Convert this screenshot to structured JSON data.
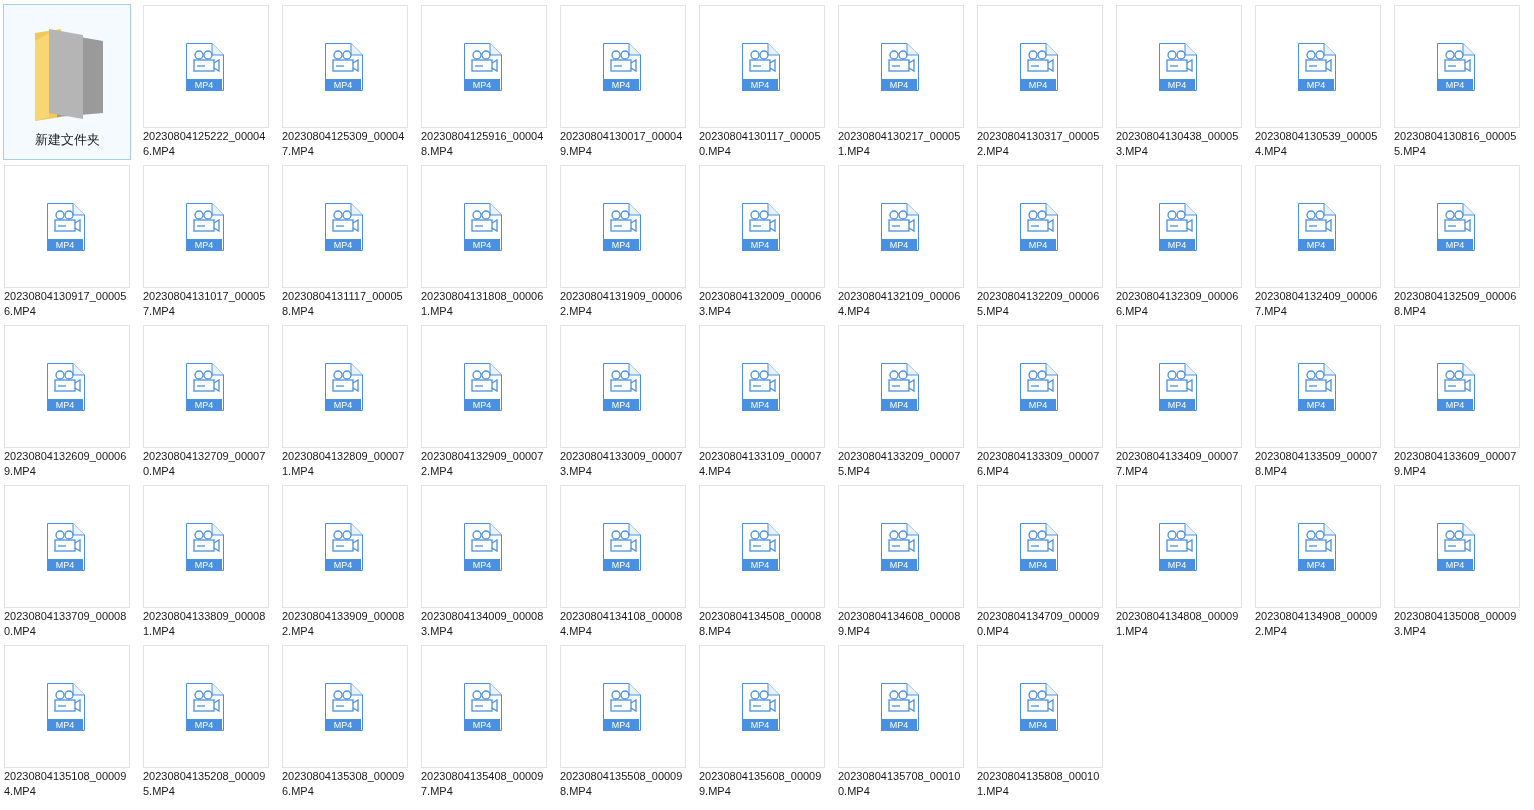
{
  "items": [
    {
      "kind": "folder",
      "name": "新建文件夹",
      "selected": true
    },
    {
      "kind": "mp4",
      "badge": "MP4",
      "name": "20230804125222_000046.MP4",
      "selected": false
    },
    {
      "kind": "mp4",
      "badge": "MP4",
      "name": "20230804125309_000047.MP4",
      "selected": false
    },
    {
      "kind": "mp4",
      "badge": "MP4",
      "name": "20230804125916_000048.MP4",
      "selected": false
    },
    {
      "kind": "mp4",
      "badge": "MP4",
      "name": "20230804130017_000049.MP4",
      "selected": false
    },
    {
      "kind": "mp4",
      "badge": "MP4",
      "name": "20230804130117_000050.MP4",
      "selected": false
    },
    {
      "kind": "mp4",
      "badge": "MP4",
      "name": "20230804130217_000051.MP4",
      "selected": false
    },
    {
      "kind": "mp4",
      "badge": "MP4",
      "name": "20230804130317_000052.MP4",
      "selected": false
    },
    {
      "kind": "mp4",
      "badge": "MP4",
      "name": "20230804130438_000053.MP4",
      "selected": false
    },
    {
      "kind": "mp4",
      "badge": "MP4",
      "name": "20230804130539_000054.MP4",
      "selected": false
    },
    {
      "kind": "mp4",
      "badge": "MP4",
      "name": "20230804130816_000055.MP4",
      "selected": false
    },
    {
      "kind": "mp4",
      "badge": "MP4",
      "name": "20230804130917_000056.MP4",
      "selected": false
    },
    {
      "kind": "mp4",
      "badge": "MP4",
      "name": "20230804131017_000057.MP4",
      "selected": false
    },
    {
      "kind": "mp4",
      "badge": "MP4",
      "name": "20230804131117_000058.MP4",
      "selected": false
    },
    {
      "kind": "mp4",
      "badge": "MP4",
      "name": "20230804131808_000061.MP4",
      "selected": false
    },
    {
      "kind": "mp4",
      "badge": "MP4",
      "name": "20230804131909_000062.MP4",
      "selected": false
    },
    {
      "kind": "mp4",
      "badge": "MP4",
      "name": "20230804132009_000063.MP4",
      "selected": false
    },
    {
      "kind": "mp4",
      "badge": "MP4",
      "name": "20230804132109_000064.MP4",
      "selected": false
    },
    {
      "kind": "mp4",
      "badge": "MP4",
      "name": "20230804132209_000065.MP4",
      "selected": false
    },
    {
      "kind": "mp4",
      "badge": "MP4",
      "name": "20230804132309_000066.MP4",
      "selected": false
    },
    {
      "kind": "mp4",
      "badge": "MP4",
      "name": "20230804132409_000067.MP4",
      "selected": false
    },
    {
      "kind": "mp4",
      "badge": "MP4",
      "name": "20230804132509_000068.MP4",
      "selected": false
    },
    {
      "kind": "mp4",
      "badge": "MP4",
      "name": "20230804132609_000069.MP4",
      "selected": false
    },
    {
      "kind": "mp4",
      "badge": "MP4",
      "name": "20230804132709_000070.MP4",
      "selected": false
    },
    {
      "kind": "mp4",
      "badge": "MP4",
      "name": "20230804132809_000071.MP4",
      "selected": false
    },
    {
      "kind": "mp4",
      "badge": "MP4",
      "name": "20230804132909_000072.MP4",
      "selected": false
    },
    {
      "kind": "mp4",
      "badge": "MP4",
      "name": "20230804133009_000073.MP4",
      "selected": false
    },
    {
      "kind": "mp4",
      "badge": "MP4",
      "name": "20230804133109_000074.MP4",
      "selected": false
    },
    {
      "kind": "mp4",
      "badge": "MP4",
      "name": "20230804133209_000075.MP4",
      "selected": false
    },
    {
      "kind": "mp4",
      "badge": "MP4",
      "name": "20230804133309_000076.MP4",
      "selected": false
    },
    {
      "kind": "mp4",
      "badge": "MP4",
      "name": "20230804133409_000077.MP4",
      "selected": false
    },
    {
      "kind": "mp4",
      "badge": "MP4",
      "name": "20230804133509_000078.MP4",
      "selected": false
    },
    {
      "kind": "mp4",
      "badge": "MP4",
      "name": "20230804133609_000079.MP4",
      "selected": false
    },
    {
      "kind": "mp4",
      "badge": "MP4",
      "name": "20230804133709_000080.MP4",
      "selected": false
    },
    {
      "kind": "mp4",
      "badge": "MP4",
      "name": "20230804133809_000081.MP4",
      "selected": false
    },
    {
      "kind": "mp4",
      "badge": "MP4",
      "name": "20230804133909_000082.MP4",
      "selected": false
    },
    {
      "kind": "mp4",
      "badge": "MP4",
      "name": "20230804134009_000083.MP4",
      "selected": false
    },
    {
      "kind": "mp4",
      "badge": "MP4",
      "name": "20230804134108_000084.MP4",
      "selected": false
    },
    {
      "kind": "mp4",
      "badge": "MP4",
      "name": "20230804134508_000088.MP4",
      "selected": false
    },
    {
      "kind": "mp4",
      "badge": "MP4",
      "name": "20230804134608_000089.MP4",
      "selected": false
    },
    {
      "kind": "mp4",
      "badge": "MP4",
      "name": "20230804134709_000090.MP4",
      "selected": false
    },
    {
      "kind": "mp4",
      "badge": "MP4",
      "name": "20230804134808_000091.MP4",
      "selected": false
    },
    {
      "kind": "mp4",
      "badge": "MP4",
      "name": "20230804134908_000092.MP4",
      "selected": false
    },
    {
      "kind": "mp4",
      "badge": "MP4",
      "name": "20230804135008_000093.MP4",
      "selected": false
    },
    {
      "kind": "mp4",
      "badge": "MP4",
      "name": "20230804135108_000094.MP4",
      "selected": false
    },
    {
      "kind": "mp4",
      "badge": "MP4",
      "name": "20230804135208_000095.MP4",
      "selected": false
    },
    {
      "kind": "mp4",
      "badge": "MP4",
      "name": "20230804135308_000096.MP4",
      "selected": false
    },
    {
      "kind": "mp4",
      "badge": "MP4",
      "name": "20230804135408_000097.MP4",
      "selected": false
    },
    {
      "kind": "mp4",
      "badge": "MP4",
      "name": "20230804135508_000098.MP4",
      "selected": false
    },
    {
      "kind": "mp4",
      "badge": "MP4",
      "name": "20230804135608_000099.MP4",
      "selected": false
    },
    {
      "kind": "mp4",
      "badge": "MP4",
      "name": "20230804135708_000100.MP4",
      "selected": false
    },
    {
      "kind": "mp4",
      "badge": "MP4",
      "name": "20230804135808_000101.MP4",
      "selected": false
    }
  ]
}
